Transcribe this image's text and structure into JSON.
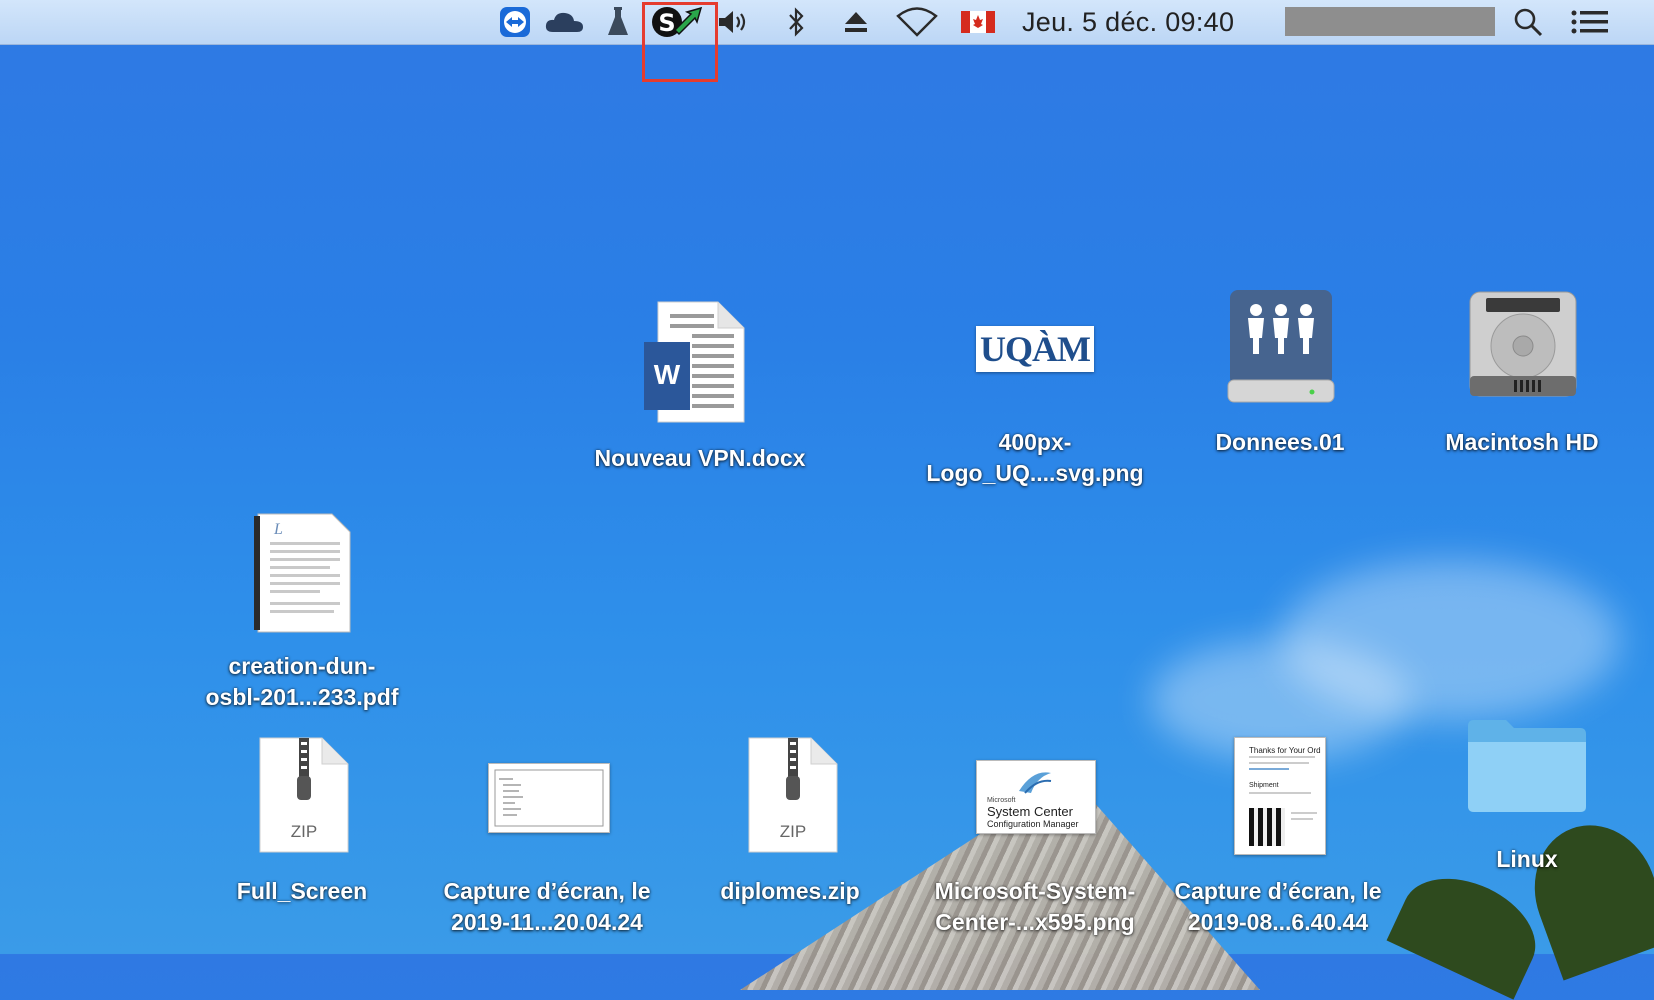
{
  "menubar": {
    "clock": "Jeu. 5 déc.  09:40",
    "icons": [
      "teamviewer-icon",
      "onedrive-icon",
      "flask-icon",
      "sync-status-icon",
      "volume-icon",
      "bluetooth-icon",
      "eject-icon",
      "wifi-icon",
      "canada-flag-icon",
      "spotlight-search-icon",
      "notification-center-icon"
    ]
  },
  "desktop": {
    "items": [
      {
        "label_line1": "Nouveau VPN.docx",
        "label_line2": ""
      },
      {
        "label_line1": "400px-",
        "label_line2": "Logo_UQ....svg.png"
      },
      {
        "label_line1": "Donnees.01",
        "label_line2": ""
      },
      {
        "label_line1": "Macintosh HD",
        "label_line2": ""
      },
      {
        "label_line1": "creation-dun-",
        "label_line2": "osbl-201...233.pdf"
      },
      {
        "label_line1": "Full_Screen",
        "label_line2": ""
      },
      {
        "label_line1": "Capture d’écran, le",
        "label_line2": "2019-11...20.04.24"
      },
      {
        "label_line1": "diplomes.zip",
        "label_line2": ""
      },
      {
        "label_line1": "Microsoft-System-",
        "label_line2": "Center-...x595.png"
      },
      {
        "label_line1": "Capture d’écran, le",
        "label_line2": "2019-08...6.40.44"
      },
      {
        "label_line1": "Linux",
        "label_line2": ""
      }
    ],
    "uqam_logo_text": "UQÀM",
    "zip_text": "ZIP",
    "word_letter": "W",
    "sc_brand": "Microsoft",
    "sc_line1": "System Center",
    "sc_line2": "Configuration Manager",
    "receipt_title": "Thanks for Your Ord",
    "receipt_shipment": "Shipment"
  }
}
